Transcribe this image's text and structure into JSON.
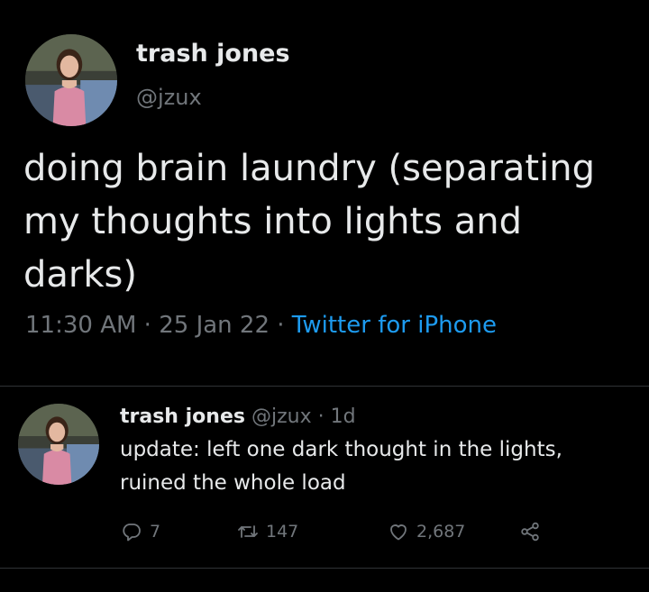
{
  "main_tweet": {
    "display_name": "trash jones",
    "handle": "@jzux",
    "text": "doing brain laundry (separating my thoughts into lights and darks)",
    "time": "11:30 AM",
    "date": "25 Jan 22",
    "separator": " · ",
    "source": "Twitter for iPhone"
  },
  "reply_tweet": {
    "display_name": "trash jones",
    "handle": "@jzux",
    "dot": " · ",
    "age": "1d",
    "text": "update: left one dark thought in the lights, ruined the whole load",
    "actions": {
      "reply_count": "7",
      "retweet_count": "147",
      "like_count": "2,687"
    }
  },
  "colors": {
    "background": "#000000",
    "text_primary": "#e7e9ea",
    "text_secondary": "#71767b",
    "link": "#1d9bf0",
    "divider": "#2f3336"
  },
  "icons": [
    "reply-icon",
    "retweet-icon",
    "like-icon",
    "share-icon"
  ]
}
